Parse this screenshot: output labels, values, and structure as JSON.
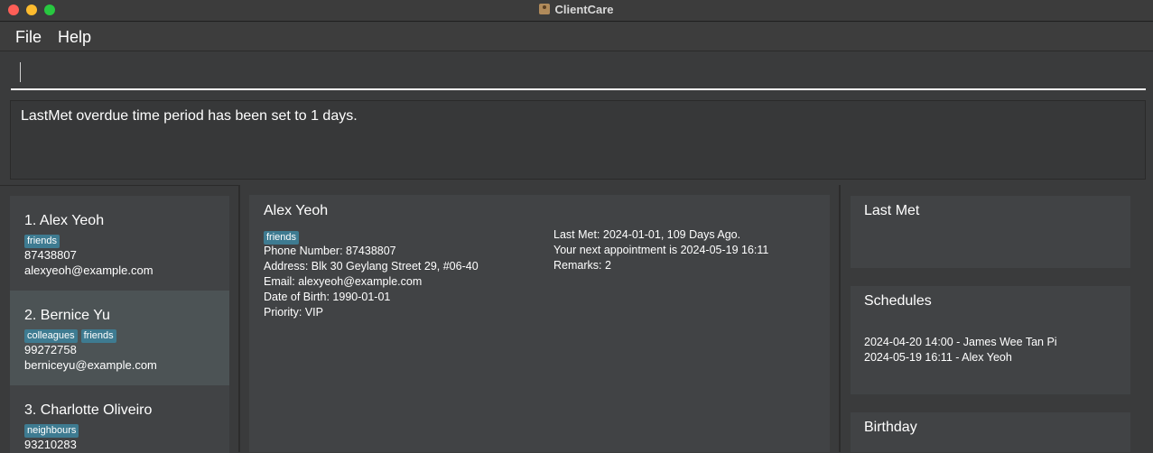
{
  "window": {
    "title": "ClientCare",
    "app_icon": "contact-card-icon"
  },
  "menu": {
    "file": "File",
    "help": "Help"
  },
  "command": {
    "value": "",
    "placeholder": ""
  },
  "result": {
    "message": "LastMet overdue time period has been set to 1 days."
  },
  "persons": [
    {
      "index_name": "1.  Alex Yeoh",
      "tags": [
        "friends"
      ],
      "phone": "87438807",
      "email": "alexyeoh@example.com"
    },
    {
      "index_name": "2.  Bernice Yu",
      "tags": [
        "colleagues",
        "friends"
      ],
      "phone": "99272758",
      "email": "berniceyu@example.com"
    },
    {
      "index_name": "3.  Charlotte Oliveiro",
      "tags": [
        "neighbours"
      ],
      "phone": "93210283",
      "email": ""
    }
  ],
  "detail": {
    "name": "Alex Yeoh",
    "tag": "friends",
    "phone": "Phone Number: 87438807",
    "address": "Address: Blk 30 Geylang Street 29, #06-40",
    "email": "Email: alexyeoh@example.com",
    "dob": "Date of Birth: 1990-01-01",
    "priority": "Priority: VIP",
    "last_met": "Last Met: 2024-01-01, 109 Days Ago.",
    "next_appointment": "Your next appointment is 2024-05-19 16:11",
    "remarks": "Remarks: 2"
  },
  "side": {
    "last_met_title": "Last Met",
    "schedules_title": "Schedules",
    "schedules": [
      "2024-04-20 14:00 - James Wee Tan Pi",
      "2024-05-19 16:11 - Alex Yeoh"
    ],
    "birthday_title": "Birthday"
  },
  "colors": {
    "tag": "#3e7b91",
    "selected_card": "#4c5355",
    "card": "#414345",
    "background": "#3a3b3c"
  }
}
